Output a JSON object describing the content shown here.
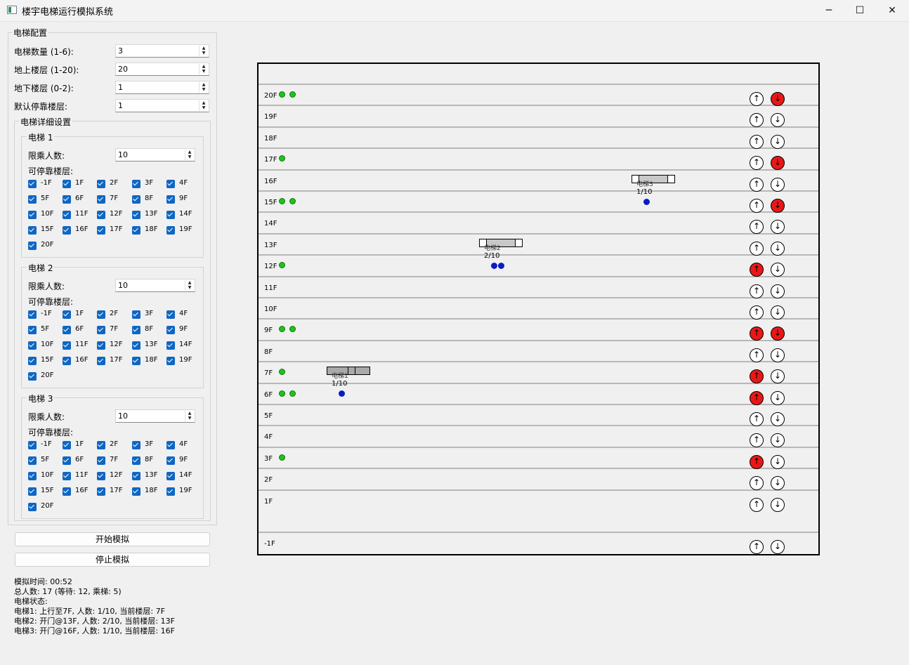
{
  "window": {
    "title": "楼宇电梯运行模拟系统",
    "minimize": "─",
    "maximize": "☐",
    "close": "✕"
  },
  "config": {
    "legend": "电梯配置",
    "elevator_count_label": "电梯数量 (1-6):",
    "elevator_count": "3",
    "above_floors_label": "地上楼层 (1-20):",
    "above_floors": "20",
    "below_floors_label": "地下楼层 (0-2):",
    "below_floors": "1",
    "default_floor_label": "默认停靠楼层:",
    "default_floor": "1",
    "details_legend": "电梯详细设置",
    "capacity_label": "限乘人数:",
    "stops_label": "可停靠楼层:",
    "floor_options": [
      "-1F",
      "1F",
      "2F",
      "3F",
      "4F",
      "5F",
      "6F",
      "7F",
      "8F",
      "9F",
      "10F",
      "11F",
      "12F",
      "13F",
      "14F",
      "15F",
      "16F",
      "17F",
      "18F",
      "19F",
      "20F"
    ],
    "elevators": [
      {
        "name": "电梯 1",
        "capacity": "10"
      },
      {
        "name": "电梯 2",
        "capacity": "10"
      },
      {
        "name": "电梯 3",
        "capacity": "10"
      }
    ]
  },
  "buttons": {
    "start": "开始模拟",
    "stop": "停止模拟"
  },
  "status": {
    "time": "模拟时间: 00:52",
    "total": "总人数: 17 (等待: 12, 乘梯: 5)",
    "header": "电梯状态:",
    "lines": [
      "电梯1: 上行至7F, 人数: 1/10, 当前楼层: 7F",
      "电梯2: 开门@13F, 人数: 2/10, 当前楼层: 13F",
      "电梯3: 开门@16F, 人数: 1/10, 当前楼层: 16F"
    ]
  },
  "building": {
    "floors": [
      {
        "label": "20F",
        "waiting": 2,
        "up": null,
        "down": true
      },
      {
        "label": "19F",
        "waiting": 0,
        "up": false,
        "down": false
      },
      {
        "label": "18F",
        "waiting": 0,
        "up": false,
        "down": false
      },
      {
        "label": "17F",
        "waiting": 1,
        "up": false,
        "down": true
      },
      {
        "label": "16F",
        "waiting": 0,
        "up": false,
        "down": false
      },
      {
        "label": "15F",
        "waiting": 2,
        "up": false,
        "down": true
      },
      {
        "label": "14F",
        "waiting": 0,
        "up": false,
        "down": false
      },
      {
        "label": "13F",
        "waiting": 0,
        "up": false,
        "down": false
      },
      {
        "label": "12F",
        "waiting": 1,
        "up": true,
        "down": false
      },
      {
        "label": "11F",
        "waiting": 0,
        "up": false,
        "down": false
      },
      {
        "label": "10F",
        "waiting": 0,
        "up": false,
        "down": false
      },
      {
        "label": "9F",
        "waiting": 2,
        "up": true,
        "down": true
      },
      {
        "label": "8F",
        "waiting": 0,
        "up": false,
        "down": false
      },
      {
        "label": "7F",
        "waiting": 1,
        "up": true,
        "down": false
      },
      {
        "label": "6F",
        "waiting": 2,
        "up": true,
        "down": false
      },
      {
        "label": "5F",
        "waiting": 0,
        "up": false,
        "down": false
      },
      {
        "label": "4F",
        "waiting": 0,
        "up": false,
        "down": false
      },
      {
        "label": "3F",
        "waiting": 1,
        "up": true,
        "down": false
      },
      {
        "label": "2F",
        "waiting": 0,
        "up": false,
        "down": false
      },
      {
        "label": "1F",
        "waiting": 0,
        "up": false,
        "down": false
      },
      {
        "label": "-1F",
        "waiting": 0,
        "up": false,
        "down": false
      }
    ],
    "up_symbol": "↑",
    "down_symbol": "↓",
    "cars": [
      {
        "name": "电梯1",
        "load": "1/10",
        "floor": "7F",
        "passengers": 1,
        "doors_open": false,
        "color": "#a9a9a9"
      },
      {
        "name": "电梯2",
        "load": "2/10",
        "floor": "13F",
        "passengers": 2,
        "doors_open": true,
        "color": "#c8c8c8"
      },
      {
        "name": "电梯3",
        "load": "1/10",
        "floor": "16F",
        "passengers": 1,
        "doors_open": true,
        "color": "#c8c8c8"
      }
    ]
  }
}
